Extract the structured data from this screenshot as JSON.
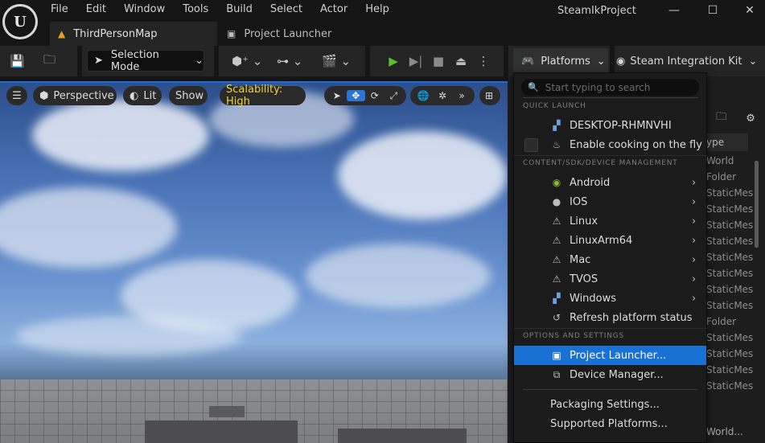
{
  "app": {
    "title": "SteamIkProject",
    "logo_letter": "U"
  },
  "menubar": [
    "File",
    "Edit",
    "Window",
    "Tools",
    "Build",
    "Select",
    "Actor",
    "Help"
  ],
  "window_controls": {
    "minimize": "—",
    "maximize": "☐",
    "close": "✕"
  },
  "tabs": [
    {
      "label": "ThirdPersonMap",
      "icon": "map-icon"
    },
    {
      "label": "Project Launcher",
      "icon": "launcher-icon"
    }
  ],
  "toolbar": {
    "selection_mode": "Selection Mode",
    "platforms": "Platforms",
    "steam_kit": "Steam Integration Kit"
  },
  "viewport": {
    "perspective": "Perspective",
    "lit": "Lit",
    "show": "Show",
    "scalability": "Scalability: High"
  },
  "outliner": {
    "column": "ype",
    "rows": [
      "World",
      "Folder",
      "StaticMes",
      "StaticMes",
      "StaticMes",
      "StaticMes",
      "StaticMes",
      "StaticMes",
      "StaticMes",
      "StaticMes",
      "Folder",
      "StaticMes",
      "StaticMes",
      "StaticMes",
      "StaticMes"
    ],
    "bottom": "World..."
  },
  "menu": {
    "search_placeholder": "Start typing to search",
    "sections": {
      "quick_launch": "QUICK LAUNCH",
      "content": "CONTENT/SDK/DEVICE MANAGEMENT",
      "options": "OPTIONS AND SETTINGS"
    },
    "quick_launch": [
      {
        "label": "DESKTOP-RHMNVHI"
      },
      {
        "label": "Enable cooking on the fly"
      }
    ],
    "platforms": [
      {
        "label": "Android"
      },
      {
        "label": "IOS"
      },
      {
        "label": "Linux"
      },
      {
        "label": "LinuxArm64"
      },
      {
        "label": "Mac"
      },
      {
        "label": "TVOS"
      },
      {
        "label": "Windows"
      },
      {
        "label": "Refresh platform status"
      }
    ],
    "options": [
      {
        "label": "Project Launcher..."
      },
      {
        "label": "Device Manager..."
      }
    ],
    "extra": [
      {
        "label": "Packaging Settings..."
      },
      {
        "label": "Supported Platforms..."
      }
    ]
  },
  "colors": {
    "accent": "#1971d4",
    "scalability": "#f2d23a",
    "play": "#5bbf2a"
  }
}
